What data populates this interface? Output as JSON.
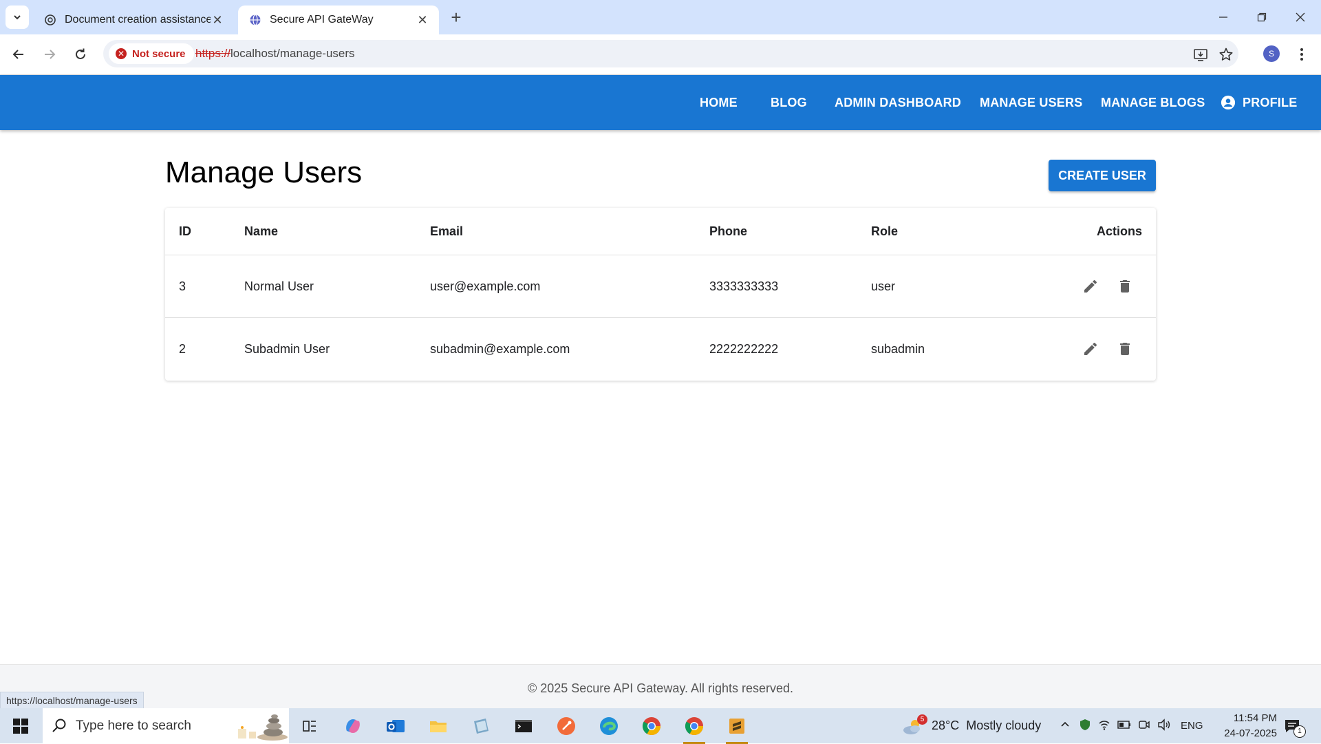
{
  "browser": {
    "tabs": [
      {
        "title": "Document creation assistance",
        "active": false
      },
      {
        "title": "Secure API GateWay",
        "active": true
      }
    ],
    "security_label": "Not secure",
    "url_scheme": "https://",
    "url_rest": "localhost/manage-users",
    "profile_initial": "S",
    "status_url": "https://localhost/manage-users"
  },
  "navbar": {
    "items": [
      "HOME",
      "BLOG",
      "ADMIN DASHBOARD",
      "MANAGE USERS",
      "MANAGE BLOGS",
      "PROFILE"
    ],
    "color": "#1976d2"
  },
  "page": {
    "title": "Manage Users",
    "create_button": "CREATE USER"
  },
  "table": {
    "headers": [
      "ID",
      "Name",
      "Email",
      "Phone",
      "Role",
      "Actions"
    ],
    "rows": [
      {
        "id": "3",
        "name": "Normal User",
        "email": "user@example.com",
        "phone": "3333333333",
        "role": "user"
      },
      {
        "id": "2",
        "name": "Subadmin User",
        "email": "subadmin@example.com",
        "phone": "2222222222",
        "role": "subadmin"
      }
    ]
  },
  "footer": {
    "text": "© 2025 Secure API Gateway. All rights reserved."
  },
  "taskbar": {
    "search_placeholder": "Type here to search",
    "weather_temp": "28°C",
    "weather_desc": "Mostly cloudy",
    "weather_badge": "5",
    "language": "ENG",
    "time": "11:54 PM",
    "date": "24-07-2025",
    "notification_count": "1"
  }
}
